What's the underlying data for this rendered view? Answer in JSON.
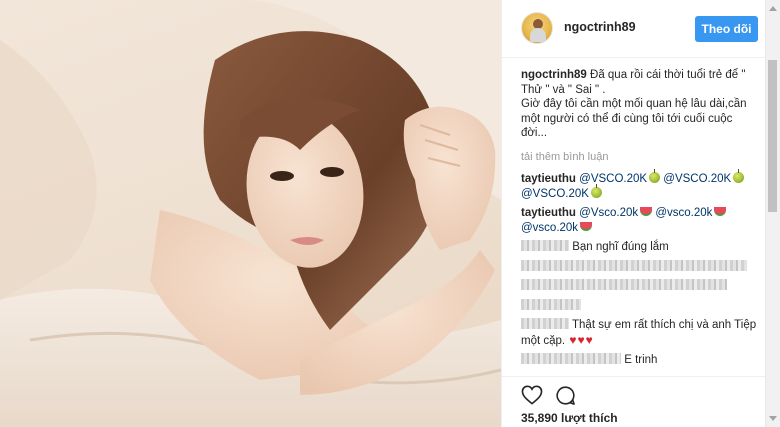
{
  "post": {
    "username": "ngoctrinh89",
    "follow_label": "Theo dõi",
    "caption": {
      "username": "ngoctrinh89",
      "text": "Đã qua rồi cái thời tuổi trẻ để \" Thử \" và \" Sai \" .\nGiờ đây tôi cần một mối quan hệ lâu dài,cần một người có thể đi cùng tôi tới cuối cuộc đời..."
    },
    "load_more": "tải thêm bình luận",
    "comments": [
      {
        "username": "taytieuthu",
        "mentions": [
          "@VSCO.20K",
          "@VSCO.20K",
          "@VSCO.20K"
        ],
        "emoji": "green-apple"
      },
      {
        "username": "taytieuthu",
        "mentions": [
          "@Vsco.20k",
          "@vsco.20k",
          "@vsco.20k"
        ],
        "emoji": "watermelon"
      },
      {
        "text": "Bạn nghĩ đúng lắm"
      },
      {
        "text": "Thật sự em rất thích chị và anh Tiệp một cặp."
      },
      {
        "text": "E trinh"
      }
    ],
    "likes": "35,890 lượt thích",
    "icons": {
      "like": "heart-outline-icon",
      "comment": "comment-bubble-icon"
    },
    "colors": {
      "follow_button": "#3897f0",
      "heart": "#d9252f"
    }
  }
}
